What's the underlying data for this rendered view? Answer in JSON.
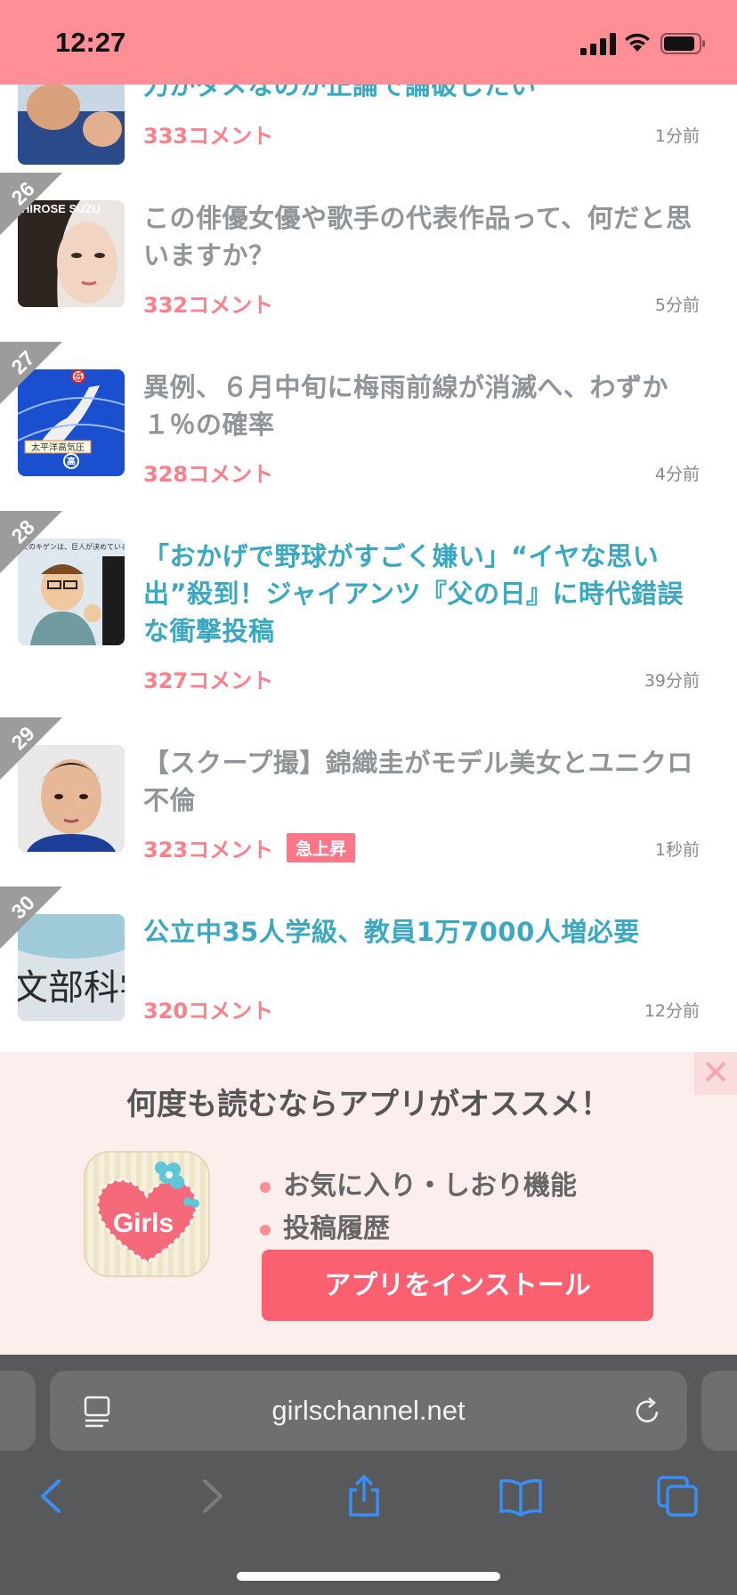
{
  "status_bar": {
    "time": "12:27"
  },
  "topics": [
    {
      "rank": "",
      "title": "力がダメなのか正論で論破したい",
      "comments": "333コメント",
      "ago": "1分前",
      "color": "blue"
    },
    {
      "rank": "26",
      "title": "この俳優女優や歌手の代表作品って、何だと思いますか？",
      "comments": "332コメント",
      "ago": "5分前",
      "color": "gray"
    },
    {
      "rank": "27",
      "title": "異例、６月中旬に梅雨前線が消滅へ、わずか１％の確率",
      "comments": "328コメント",
      "ago": "4分前",
      "color": "gray"
    },
    {
      "rank": "28",
      "title": "「おかげで野球がすごく嫌い」“イヤな思い出”殺到！ジャイアンツ『父の日』に時代錯誤な衝撃投稿",
      "comments": "327コメント",
      "ago": "39分前",
      "color": "blue"
    },
    {
      "rank": "29",
      "title": "【スクープ撮】錦織圭がモデル美女とユニクロ不倫",
      "comments": "323コメント",
      "ago": "1秒前",
      "color": "gray",
      "badge": "急上昇"
    },
    {
      "rank": "30",
      "title": "公立中35人学級、教員1万7000人増必要",
      "comments": "320コメント",
      "ago": "12分前",
      "color": "blue"
    }
  ],
  "thumb_text": {
    "t26": "HIROSE SUZU",
    "t27_label": "太平洋高気圧",
    "t27_mark": "高",
    "t27_low": "低",
    "t28": "父のキゲンは、巨人が決めている。",
    "t30": "文部科学"
  },
  "banner": {
    "headline": "何度も読むならアプリがオススメ！",
    "features": [
      "お気に入り・しおり機能",
      "投稿履歴"
    ],
    "install_label": "アプリをインストール",
    "app_icon_text": "Girls",
    "close_symbol": "✕"
  },
  "browser": {
    "url": "girlschannel.net"
  },
  "colors": {
    "status_bar": "#ff8f97",
    "title_blue": "#3aa8c1",
    "title_gray": "#8f9598",
    "comment_pink": "#fc7f8b",
    "install_button": "#fa6070"
  }
}
